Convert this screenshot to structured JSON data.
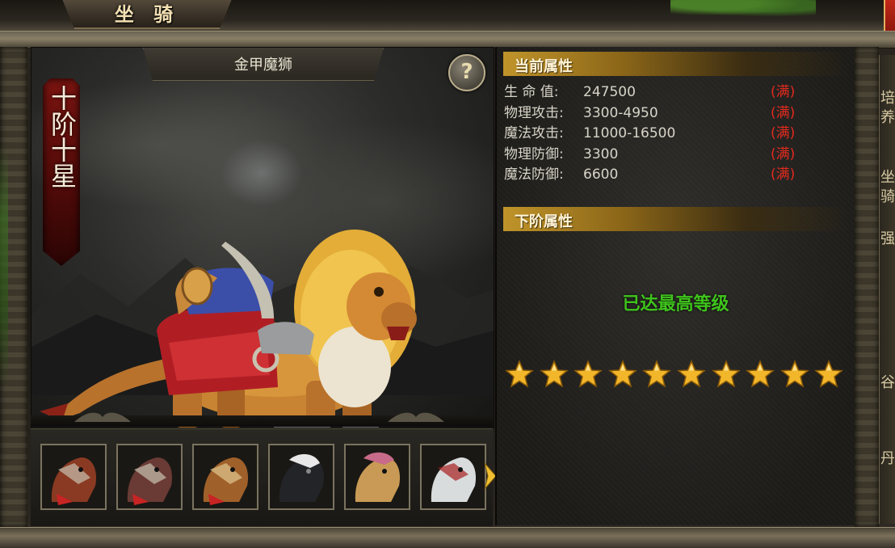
{
  "window": {
    "title": "坐 骑"
  },
  "display": {
    "mount_name": "金甲魔狮",
    "help_label": "?",
    "rank": "十阶十星"
  },
  "thumbnails": [
    {
      "name": "mount-thumb-1",
      "color": "#8a3a22",
      "selected": false
    },
    {
      "name": "mount-thumb-2",
      "color": "#6a3a34",
      "selected": false
    },
    {
      "name": "mount-thumb-3",
      "color": "#a0602a",
      "selected": false
    },
    {
      "name": "mount-thumb-4",
      "color": "#222428",
      "selected": false
    },
    {
      "name": "mount-thumb-5",
      "color": "#c89a55",
      "selected": false
    },
    {
      "name": "mount-thumb-6",
      "color": "#d8dcdc",
      "selected": false
    }
  ],
  "current_stats": {
    "header": "当前属性",
    "rows": [
      {
        "label": "生  命  值:",
        "value": "247500",
        "status": "(满)"
      },
      {
        "label": "物理攻击:",
        "value": "3300-4950",
        "status": "(满)"
      },
      {
        "label": "魔法攻击:",
        "value": "11000-16500",
        "status": "(满)"
      },
      {
        "label": "物理防御:",
        "value": "3300",
        "status": "(满)"
      },
      {
        "label": "魔法防御:",
        "value": "6600",
        "status": "(满)"
      }
    ]
  },
  "next_stats": {
    "header": "下阶属性",
    "max_message": "已达最高等级"
  },
  "star_rating": {
    "filled": 10,
    "total": 10
  },
  "side_tabs": [
    "培养",
    "坐骑",
    "强",
    "谷",
    "丹"
  ],
  "colors": {
    "accent_gold": "#c0942a",
    "full_red": "#e32a1e",
    "max_green": "#3fc41c",
    "banner_red": "#7a1410"
  }
}
